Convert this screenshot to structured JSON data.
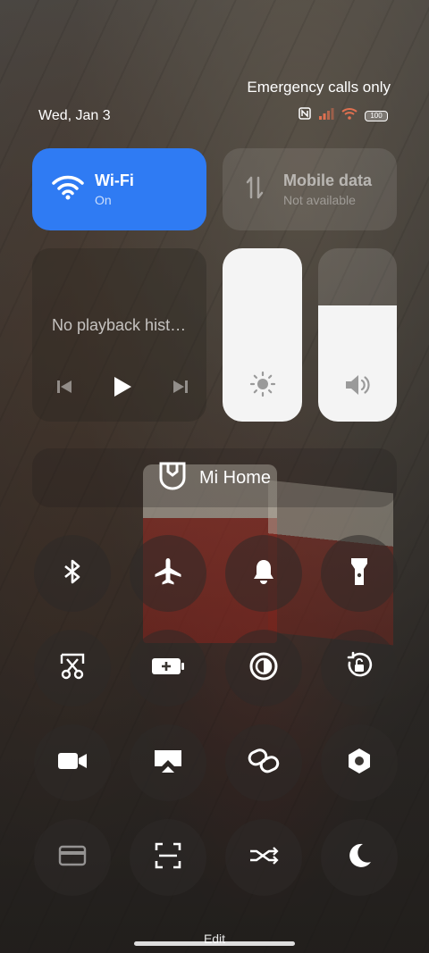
{
  "status_bar": {
    "carrier_text": "Emergency calls only",
    "date": "Wed, Jan 3",
    "battery_level": "100",
    "icons": [
      "nfc-icon",
      "signal-icon",
      "wifi-icon",
      "battery-icon"
    ]
  },
  "tiles": {
    "wifi": {
      "title": "Wi-Fi",
      "status": "On",
      "color": "#2f7bf3"
    },
    "mobile_data": {
      "title": "Mobile data",
      "status": "Not available"
    }
  },
  "media": {
    "placeholder": "No playback hist…",
    "controls": [
      "previous-icon",
      "play-icon",
      "next-icon"
    ]
  },
  "sliders": {
    "brightness": {
      "level": 1.0,
      "icon": "sun-icon"
    },
    "volume": {
      "level": 0.67,
      "icon": "speaker-icon"
    }
  },
  "mi_home": {
    "label": "Mi Home",
    "icon": "mi-home-icon"
  },
  "toggles": [
    {
      "name": "bluetooth",
      "icon": "bluetooth-icon",
      "active": true
    },
    {
      "name": "airplane-mode",
      "icon": "airplane-icon",
      "active": true
    },
    {
      "name": "silent",
      "icon": "bell-icon",
      "active": true
    },
    {
      "name": "flashlight",
      "icon": "flashlight-icon",
      "active": true
    },
    {
      "name": "screenshot",
      "icon": "scissors-icon",
      "active": true
    },
    {
      "name": "battery-saver",
      "icon": "battery-plus-icon",
      "active": true
    },
    {
      "name": "dark-mode",
      "icon": "contrast-icon",
      "active": true
    },
    {
      "name": "rotation-lock",
      "icon": "rotate-lock-icon",
      "active": true
    },
    {
      "name": "screen-record",
      "icon": "video-icon",
      "active": true
    },
    {
      "name": "cast",
      "icon": "cast-icon",
      "active": true
    },
    {
      "name": "link",
      "icon": "link-icon",
      "active": true
    },
    {
      "name": "settings",
      "icon": "hexagon-icon",
      "active": true
    },
    {
      "name": "card",
      "icon": "card-icon",
      "active": false
    },
    {
      "name": "scanner",
      "icon": "scan-icon",
      "active": true
    },
    {
      "name": "shuffle",
      "icon": "shuffle-icon",
      "active": true
    },
    {
      "name": "do-not-disturb",
      "icon": "moon-icon",
      "active": true
    }
  ],
  "footer": {
    "edit_label": "Edit"
  }
}
